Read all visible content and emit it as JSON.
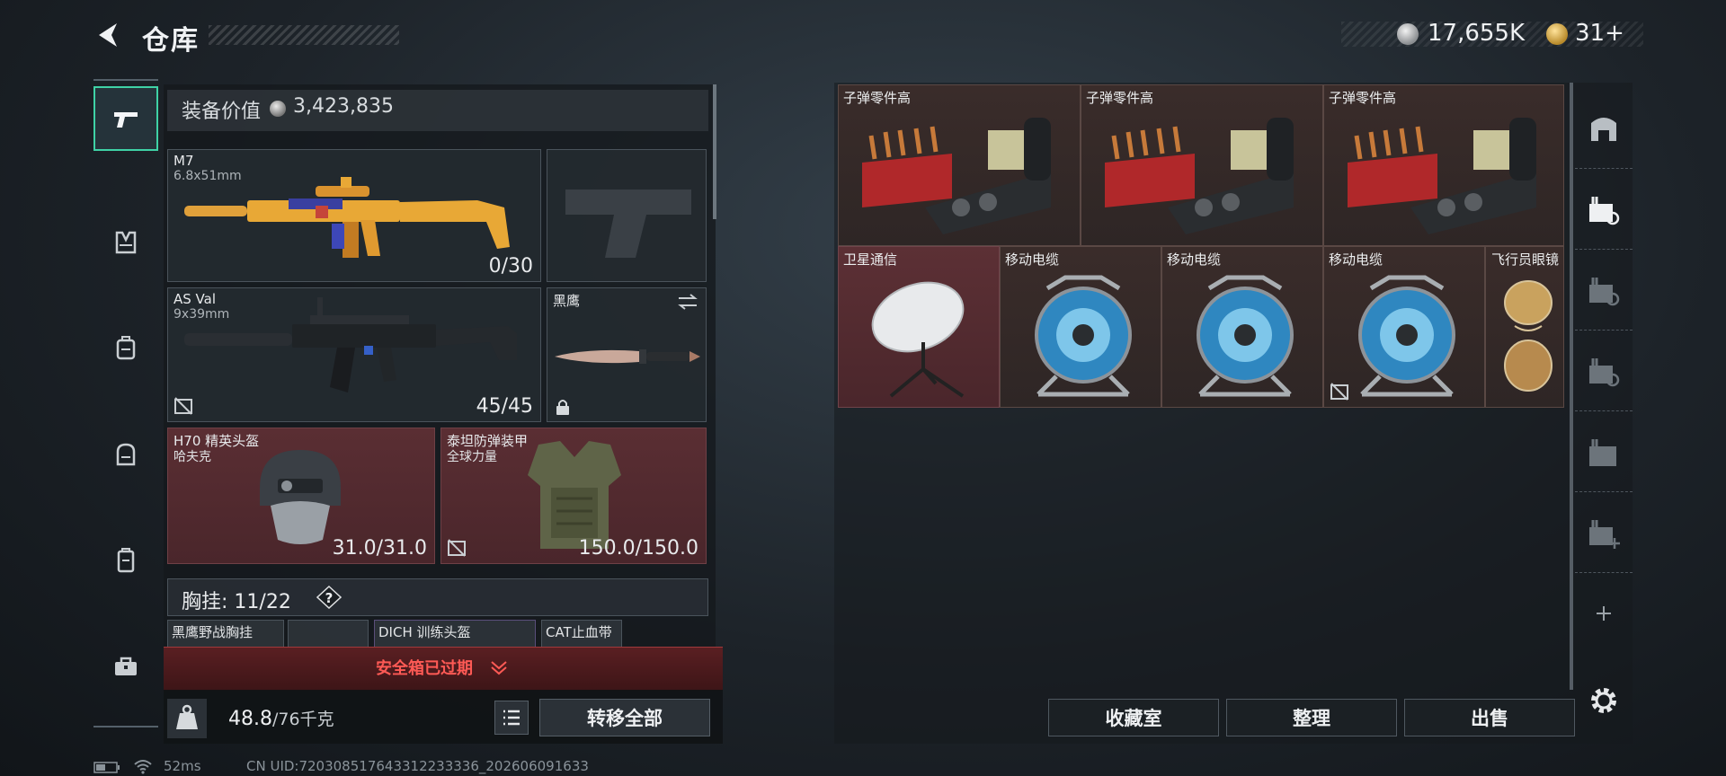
{
  "header": {
    "title": "仓库"
  },
  "currency": {
    "silver": "17,655K",
    "gold": "31+"
  },
  "left_rail": {
    "items": [
      "weapon",
      "vest",
      "backpack",
      "bag",
      "case",
      "toolbox"
    ]
  },
  "equipment": {
    "value_label": "装备价值",
    "value": "3,423,835",
    "primary": {
      "name": "M7",
      "caliber": "6.8x51mm",
      "ammo": "0/30"
    },
    "secondary": {
      "name": "AS Val",
      "caliber": "9x39mm",
      "ammo": "45/45"
    },
    "melee": {
      "name": "黑鹰"
    },
    "helmet": {
      "name": "H70 精英头盔",
      "brand": "哈夫克",
      "durability": "31.0/31.0"
    },
    "armor": {
      "name": "泰坦防弹装甲",
      "brand": "全球力量",
      "durability": "150.0/150.0"
    },
    "chest_rig": {
      "label": "胸挂",
      "capacity": "11/22",
      "help": "?"
    },
    "chest_items": [
      {
        "name": "黑鹰野战胸挂"
      },
      {
        "name": ""
      },
      {
        "name": "DICH 训练头盔"
      },
      {
        "name": "CAT止血带"
      }
    ]
  },
  "warning": {
    "text": "安全箱已过期"
  },
  "weight": {
    "current": "48.8",
    "max": "/76千克"
  },
  "buttons": {
    "transfer_all": "转移全部",
    "collection": "收藏室",
    "sort": "整理",
    "sell": "出售"
  },
  "storage": {
    "items": [
      {
        "name": "子弹零件高"
      },
      {
        "name": "子弹零件高"
      },
      {
        "name": "子弹零件高"
      },
      {
        "name": "卫星通信"
      },
      {
        "name": "移动电缆"
      },
      {
        "name": "移动电缆"
      },
      {
        "name": "移动电缆"
      },
      {
        "name": "飞行员眼镜"
      }
    ]
  },
  "status": {
    "ping": "52ms",
    "uid": "CN UID:720308517643312233336_202606091633"
  },
  "colors": {
    "accent": "#3fd2a6",
    "warning": "#ff5a55",
    "item_red": "#5c3035",
    "item_brown": "#3a2c2a"
  }
}
